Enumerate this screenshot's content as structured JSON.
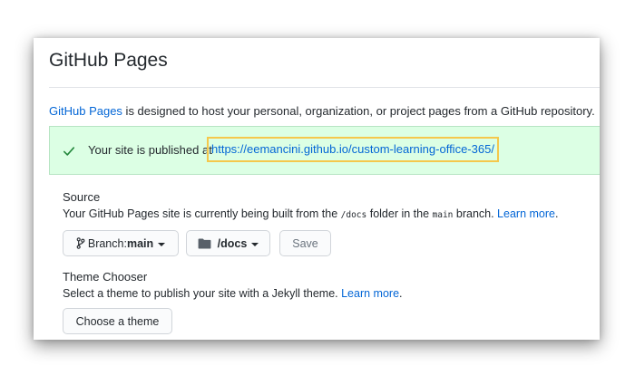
{
  "page": {
    "title": "GitHub Pages"
  },
  "intro": {
    "link_text": "GitHub Pages",
    "text": " is designed to host your personal, organization, or project pages from a GitHub repository."
  },
  "flash": {
    "text": "Your site is published at",
    "url": "https://eemancini.github.io/custom-learning-office-365/",
    "highlight_color": "#f5c84c",
    "background_color": "#dcffe4",
    "check_icon": "check-icon"
  },
  "source": {
    "heading": "Source",
    "desc_before": "Your GitHub Pages site is currently being built from the ",
    "folder_code": "/docs",
    "desc_middle": " folder in the ",
    "branch_code": "main",
    "desc_after": " branch. ",
    "learn_more": "Learn more",
    "desc_end": ".",
    "branch_prefix": "Branch: ",
    "branch_value": "main",
    "folder_value": "/docs",
    "save_label": "Save",
    "branch_icon": "git-branch-icon",
    "folder_icon": "folder-icon"
  },
  "theme": {
    "heading": "Theme Chooser",
    "desc": "Select a theme to publish your site with a Jekyll theme. ",
    "learn_more": "Learn more",
    "desc_end": ".",
    "button_label": "Choose a theme"
  }
}
